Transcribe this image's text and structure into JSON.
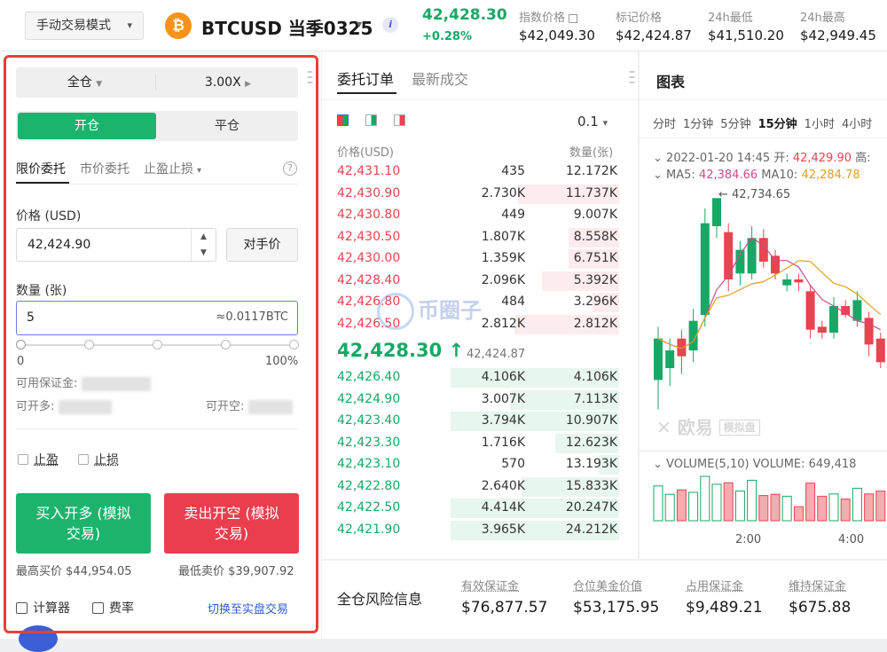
{
  "header": {
    "mode_label": "手动交易模式",
    "btc_symbol": "₿",
    "symbol": "BTCUSD 当季0325",
    "info_glyph": "i",
    "last_price": "42,428.30",
    "change_pct": "+0.28%",
    "stats": [
      {
        "label": "指数价格",
        "value": "$42,049.30"
      },
      {
        "label": "标记价格",
        "value": "$42,424.87"
      },
      {
        "label": "24h最低",
        "value": "$41,510.20"
      },
      {
        "label": "24h最高",
        "value": "$42,949.45"
      }
    ]
  },
  "order_form": {
    "margin_mode": "全仓",
    "leverage": "3.00X",
    "open_tab": "开仓",
    "close_tab": "平仓",
    "order_types": [
      "限价委托",
      "市价委托",
      "止盈止损"
    ],
    "help_glyph": "?",
    "price_label": "价格 (USD)",
    "price_value": "42,424.90",
    "counter_price_label": "对手价",
    "qty_label": "数量 (张)",
    "qty_value": "5",
    "qty_hint": "≈0.0117BTC",
    "slider_min": "0",
    "slider_max": "100%",
    "available_margin_label": "可用保证金:",
    "can_open_long_label": "可开多:",
    "can_open_short_label": "可开空:",
    "take_profit_label": "止盈",
    "stop_loss_label": "止损",
    "buy_label_line1": "买入开多 (模拟",
    "buy_label_line2": "交易)",
    "sell_label_line1": "卖出开空 (模拟",
    "sell_label_line2": "交易)",
    "max_buy": "最高买价 $44,954.05",
    "min_sell": "最低卖价 $39,907.92",
    "calculator_label": "计算器",
    "fee_label": "费率",
    "switch_label": "切换至实盘交易"
  },
  "orderbook": {
    "tab_active": "委托订单",
    "tab_other": "最新成交",
    "step": "0.1",
    "col_price": "价格(USD)",
    "col_qty": "数量(张)",
    "asks": [
      {
        "price": "42,431.10",
        "qty": "435",
        "total": "12.172K",
        "depth": 0.0
      },
      {
        "price": "42,430.90",
        "qty": "2.730K",
        "total": "11.737K",
        "depth": 0.6
      },
      {
        "price": "42,430.80",
        "qty": "449",
        "total": "9.007K",
        "depth": 0.0
      },
      {
        "price": "42,430.50",
        "qty": "1.807K",
        "total": "8.558K",
        "depth": 0.3
      },
      {
        "price": "42,430.00",
        "qty": "1.359K",
        "total": "6.751K",
        "depth": 0.3
      },
      {
        "price": "42,428.40",
        "qty": "2.096K",
        "total": "5.392K",
        "depth": 0.46
      },
      {
        "price": "42,426.80",
        "qty": "484",
        "total": "3.296K",
        "depth": 0.16
      },
      {
        "price": "42,426.50",
        "qty": "2.812K",
        "total": "2.812K",
        "depth": 0.62
      }
    ],
    "mid_price": "42,428.30",
    "mid_arrow": "↑",
    "mid_index": "42,424.87",
    "bids": [
      {
        "price": "42,426.40",
        "qty": "4.106K",
        "total": "4.106K",
        "depth": 1.0
      },
      {
        "price": "42,424.90",
        "qty": "3.007K",
        "total": "7.113K",
        "depth": 0.65
      },
      {
        "price": "42,423.40",
        "qty": "3.794K",
        "total": "10.907K",
        "depth": 1.0
      },
      {
        "price": "42,423.30",
        "qty": "1.716K",
        "total": "12.623K",
        "depth": 0.38
      },
      {
        "price": "42,423.10",
        "qty": "570",
        "total": "13.193K",
        "depth": 0.12
      },
      {
        "price": "42,422.80",
        "qty": "2.640K",
        "total": "15.833K",
        "depth": 0.58
      },
      {
        "price": "42,422.50",
        "qty": "4.414K",
        "total": "20.247K",
        "depth": 1.0
      },
      {
        "price": "42,421.90",
        "qty": "3.965K",
        "total": "24.212K",
        "depth": 1.0
      }
    ],
    "watermark": "币圈子"
  },
  "chart": {
    "title": "图表",
    "timeframes": [
      "分时",
      "1分钟",
      "5分钟",
      "15分钟",
      "1小时",
      "4小时"
    ],
    "active_timeframe": "15分钟",
    "ohlc_line": "2022-01-20 14:45  开: ",
    "ohlc_open": "42,429.90",
    "ohlc_high_label": "高:",
    "ma5_label": "MA5: ",
    "ma5_value": "42,384.66",
    "ma10_label": "MA10: ",
    "ma10_value": "42,284.78",
    "high_marker": "42,734.65",
    "watermark_brand": "欧易",
    "watermark_tag": "模拟盘",
    "volume_label": "VOLUME(5,10)  VOLUME: 649,418",
    "time_labels": [
      "2:00",
      "4:00"
    ],
    "candles": [
      {
        "o": 42120,
        "c": 42260,
        "h": 42300,
        "l": 42020,
        "up": true
      },
      {
        "o": 42160,
        "c": 42220,
        "h": 42260,
        "l": 42100,
        "up": true
      },
      {
        "o": 42260,
        "c": 42200,
        "h": 42290,
        "l": 42140,
        "up": false
      },
      {
        "o": 42220,
        "c": 42320,
        "h": 42360,
        "l": 42180,
        "up": true
      },
      {
        "o": 42340,
        "c": 42650,
        "h": 42700,
        "l": 42300,
        "up": true
      },
      {
        "o": 42640,
        "c": 42735,
        "h": 42735,
        "l": 42600,
        "up": true
      },
      {
        "o": 42620,
        "c": 42460,
        "h": 42650,
        "l": 42420,
        "up": false
      },
      {
        "o": 42480,
        "c": 42560,
        "h": 42590,
        "l": 42440,
        "up": true
      },
      {
        "o": 42480,
        "c": 42600,
        "h": 42640,
        "l": 42460,
        "up": true
      },
      {
        "o": 42600,
        "c": 42520,
        "h": 42630,
        "l": 42500,
        "up": false
      },
      {
        "o": 42540,
        "c": 42480,
        "h": 42560,
        "l": 42460,
        "up": false
      },
      {
        "o": 42440,
        "c": 42460,
        "h": 42480,
        "l": 42420,
        "up": true
      },
      {
        "o": 42460,
        "c": 42450,
        "h": 42480,
        "l": 42420,
        "up": false
      },
      {
        "o": 42420,
        "c": 42290,
        "h": 42440,
        "l": 42260,
        "up": false
      },
      {
        "o": 42300,
        "c": 42280,
        "h": 42320,
        "l": 42260,
        "up": false
      },
      {
        "o": 42280,
        "c": 42370,
        "h": 42400,
        "l": 42260,
        "up": true
      },
      {
        "o": 42370,
        "c": 42340,
        "h": 42390,
        "l": 42330,
        "up": false
      },
      {
        "o": 42390,
        "c": 42320,
        "h": 42420,
        "l": 42300,
        "up": true
      },
      {
        "o": 42330,
        "c": 42240,
        "h": 42350,
        "l": 42200,
        "up": false
      },
      {
        "o": 42260,
        "c": 42180,
        "h": 42280,
        "l": 42160,
        "up": false
      }
    ]
  },
  "risk": {
    "title": "全仓风险信息",
    "items": [
      {
        "label": "有效保证金",
        "value": "$76,877.57"
      },
      {
        "label": "仓位美金价值",
        "value": "$53,175.95"
      },
      {
        "label": "占用保证金",
        "value": "$9,489.21"
      },
      {
        "label": "维持保证金",
        "value": "$675.88"
      }
    ]
  },
  "colors": {
    "up": "#17a866",
    "down": "#e5464f",
    "accent": "#1db36d",
    "sell": "#ea3e4e",
    "highlight": "#e0423a"
  }
}
